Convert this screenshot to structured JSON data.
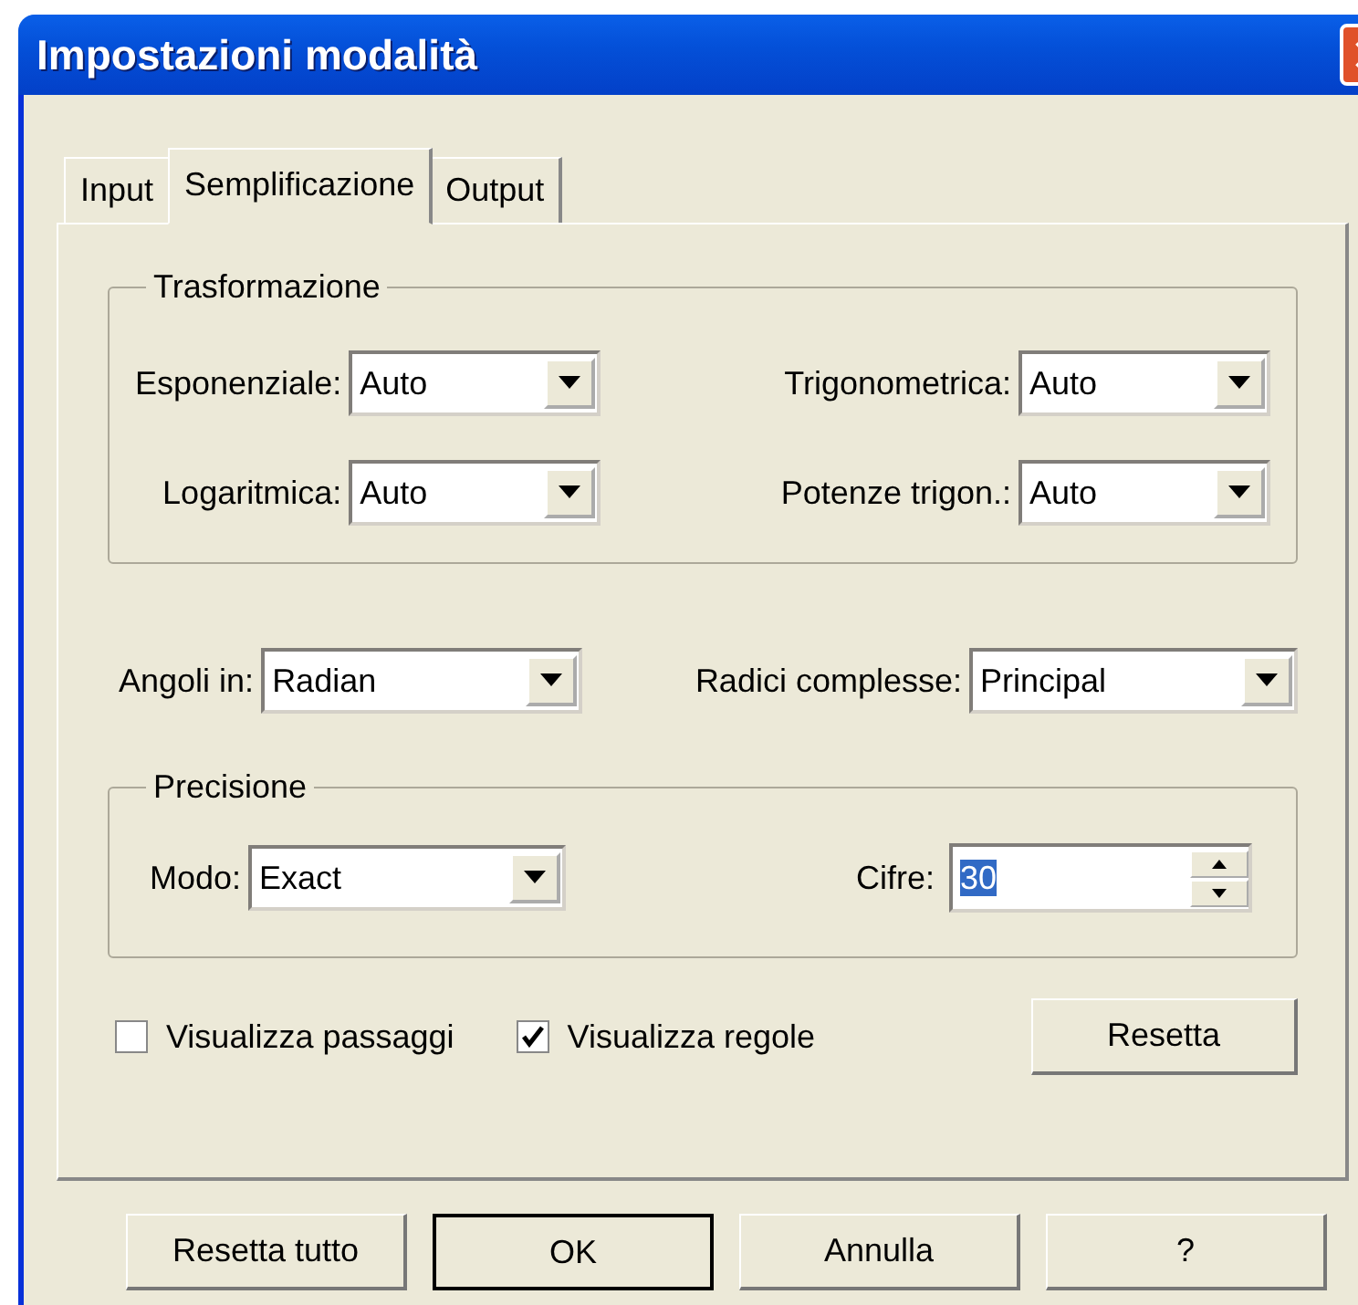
{
  "window": {
    "title": "Impostazioni modalità"
  },
  "tabs": [
    {
      "label": "Input",
      "selected": false
    },
    {
      "label": "Semplificazione",
      "selected": true
    },
    {
      "label": "Output",
      "selected": false
    }
  ],
  "transformation": {
    "title": "Trasformazione",
    "fields": [
      {
        "label": "Esponenziale:",
        "value": "Auto"
      },
      {
        "label": "Trigonometrica:",
        "value": "Auto"
      },
      {
        "label": "Logaritmica:",
        "value": "Auto"
      },
      {
        "label": "Potenze trigon.:",
        "value": "Auto"
      }
    ]
  },
  "general_fields": [
    {
      "label": "Angoli in:",
      "value": "Radian"
    },
    {
      "label": "Radici complesse:",
      "value": "Principal"
    }
  ],
  "precision": {
    "title": "Precisione",
    "mode": {
      "label": "Modo:",
      "value": "Exact"
    },
    "digits": {
      "label": "Cifre:",
      "value": "30",
      "highlighted": true
    }
  },
  "checkboxes": [
    {
      "label": "Visualizza passaggi",
      "checked": false
    },
    {
      "label": "Visualizza regole",
      "checked": true
    }
  ],
  "reset_button": "Resetta",
  "buttons": [
    {
      "label": "Resetta tutto",
      "default": false
    },
    {
      "label": "OK",
      "default": true
    },
    {
      "label": "Annulla",
      "default": false
    },
    {
      "label": "?",
      "default": false
    }
  ]
}
